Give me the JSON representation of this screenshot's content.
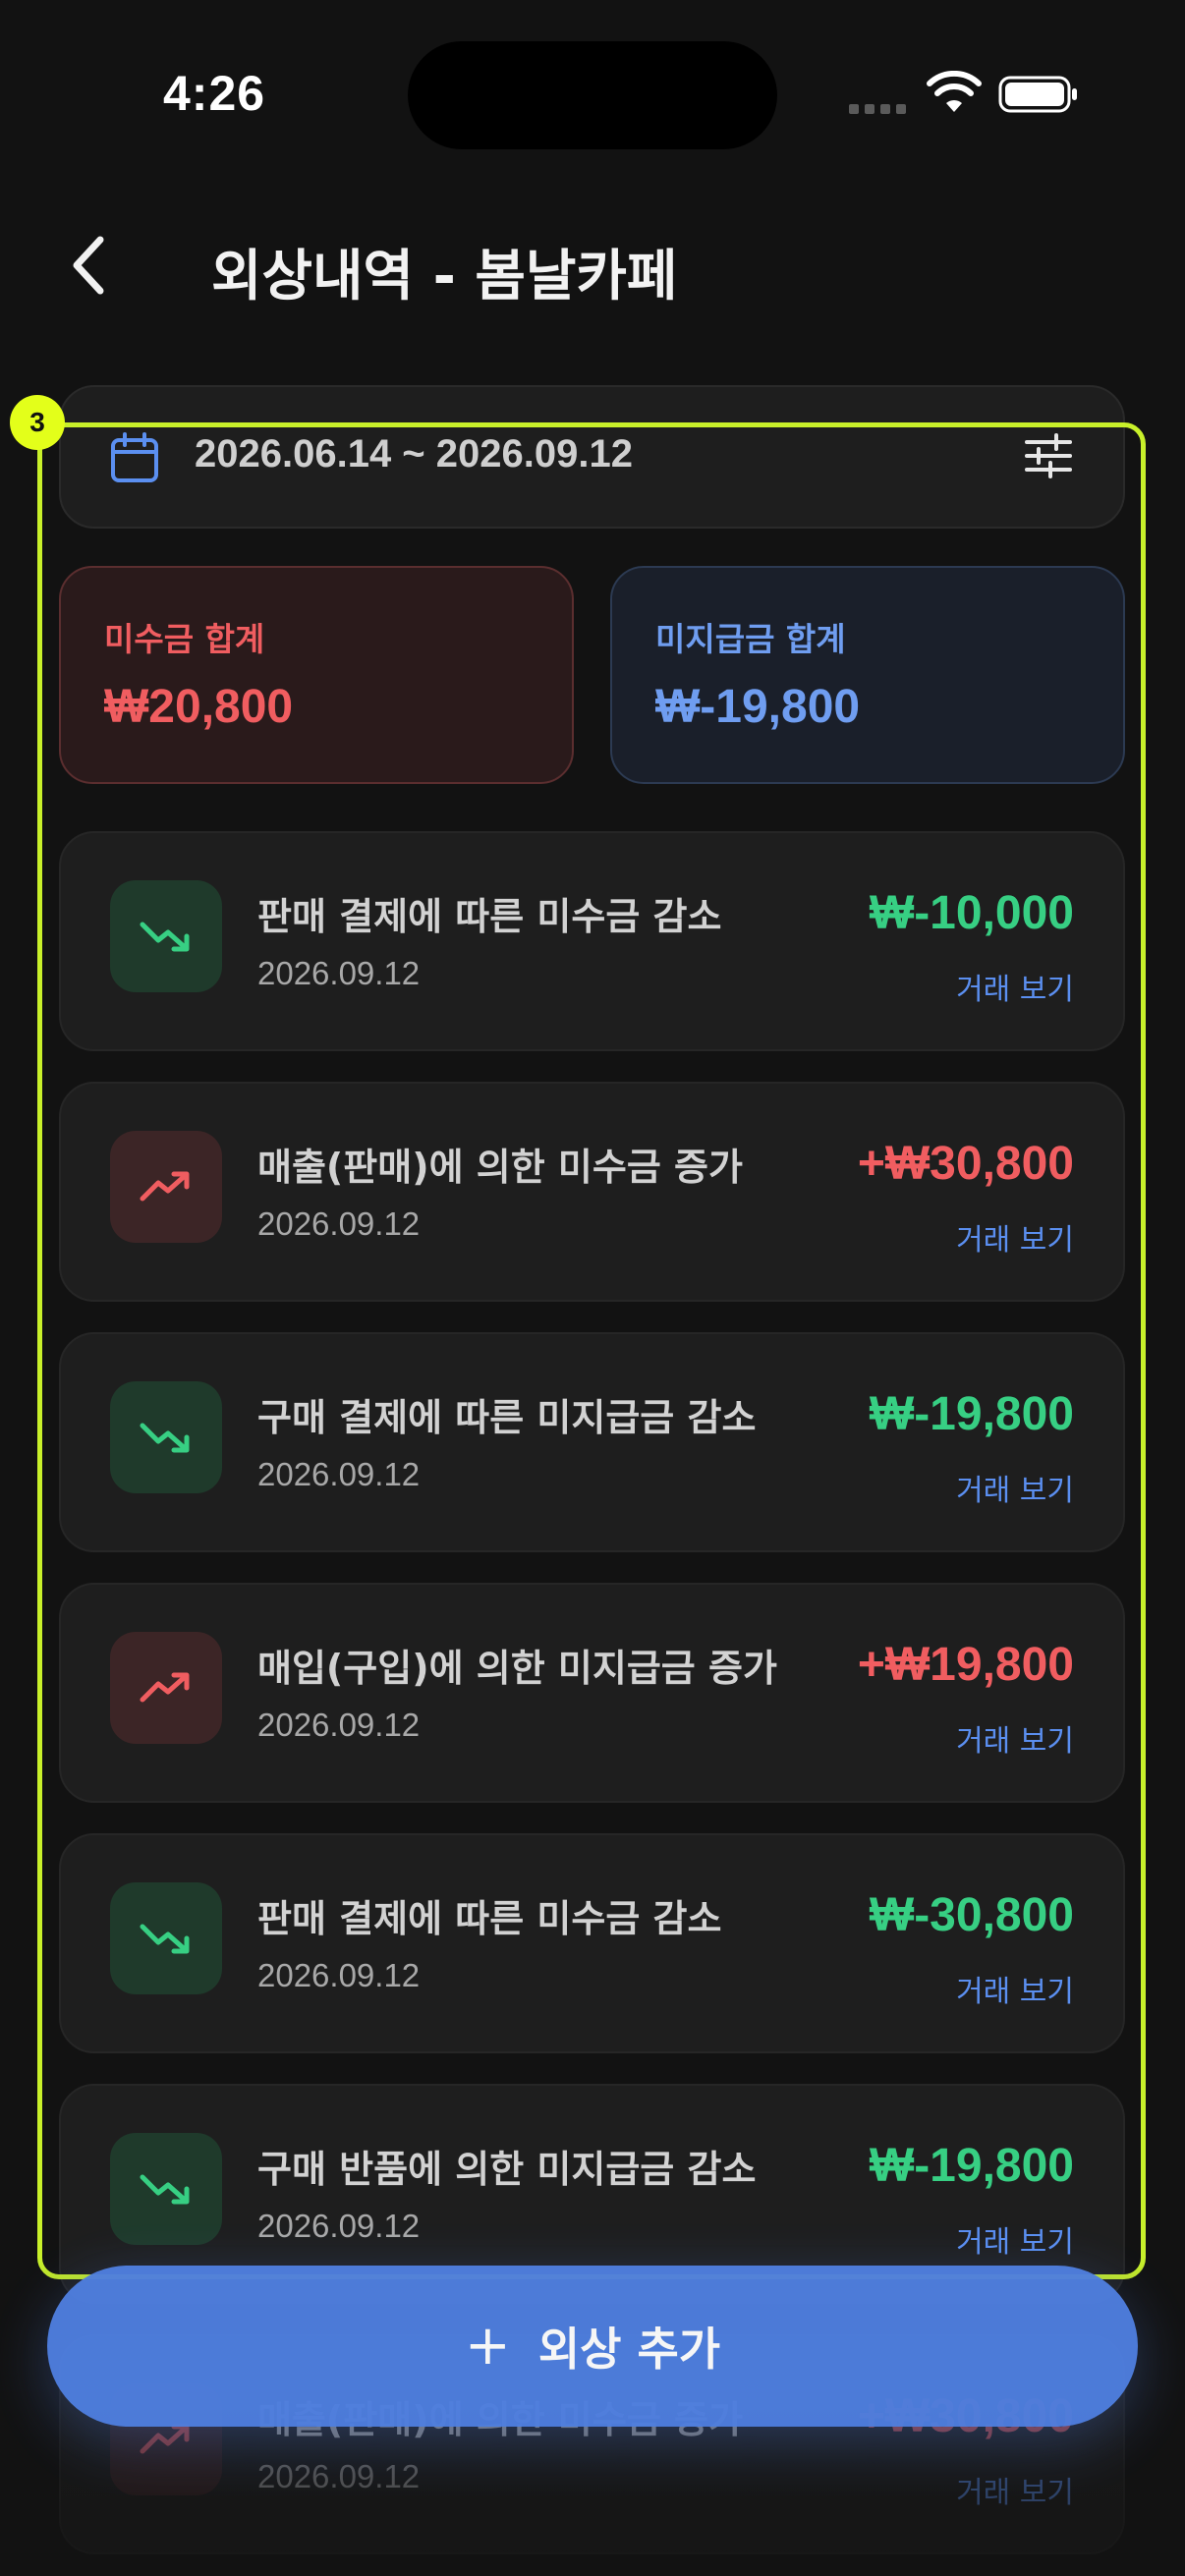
{
  "status_bar": {
    "time": "4:26"
  },
  "header": {
    "title": "외상내역 - 봄날카페"
  },
  "date_filter": {
    "range": "2026.06.14 ~ 2026.09.12"
  },
  "summary": {
    "receivable_label": "미수금 합계",
    "receivable_value": "₩20,800",
    "payable_label": "미지급금 합계",
    "payable_value": "₩-19,800"
  },
  "transactions": [
    {
      "description": "판매 결제에 따른 미수금 감소",
      "date": "2026.09.12",
      "amount": "₩-10,000",
      "direction": "down",
      "link": "거래 보기"
    },
    {
      "description": "매출(판매)에 의한 미수금 증가",
      "date": "2026.09.12",
      "amount": "+₩30,800",
      "direction": "up",
      "link": "거래 보기"
    },
    {
      "description": "구매 결제에 따른 미지급금 감소",
      "date": "2026.09.12",
      "amount": "₩-19,800",
      "direction": "down",
      "link": "거래 보기"
    },
    {
      "description": "매입(구입)에 의한 미지급금 증가",
      "date": "2026.09.12",
      "amount": "+₩19,800",
      "direction": "up",
      "link": "거래 보기"
    },
    {
      "description": "판매 결제에 따른 미수금 감소",
      "date": "2026.09.12",
      "amount": "₩-30,800",
      "direction": "down",
      "link": "거래 보기"
    },
    {
      "description": "구매 반품에 의한 미지급금 감소",
      "date": "2026.09.12",
      "amount": "₩-19,800",
      "direction": "down",
      "link": "거래 보기"
    },
    {
      "description": "매출(판매)에 의한 미수금 증가",
      "date": "2026.09.12",
      "amount": "+₩30,800",
      "direction": "up",
      "link": "거래 보기"
    }
  ],
  "selection": {
    "badge": "3"
  },
  "fab": {
    "plus": "+",
    "label": "외상 추가"
  },
  "colors": {
    "background": "#121212",
    "card": "#1e1e1e",
    "receivable_red": "#f05d60",
    "payable_blue": "#6f9df0",
    "decrease_green": "#37cf83",
    "link_blue": "#5b8ff0",
    "fab_blue": "#4f7fe0",
    "selection_lime": "#c8f02a"
  },
  "icons": {
    "back": "chevron-left-icon",
    "calendar": "calendar-icon",
    "filter": "sliders-icon",
    "decrease": "trending-down-icon",
    "increase": "trending-up-icon",
    "add": "plus-icon"
  }
}
